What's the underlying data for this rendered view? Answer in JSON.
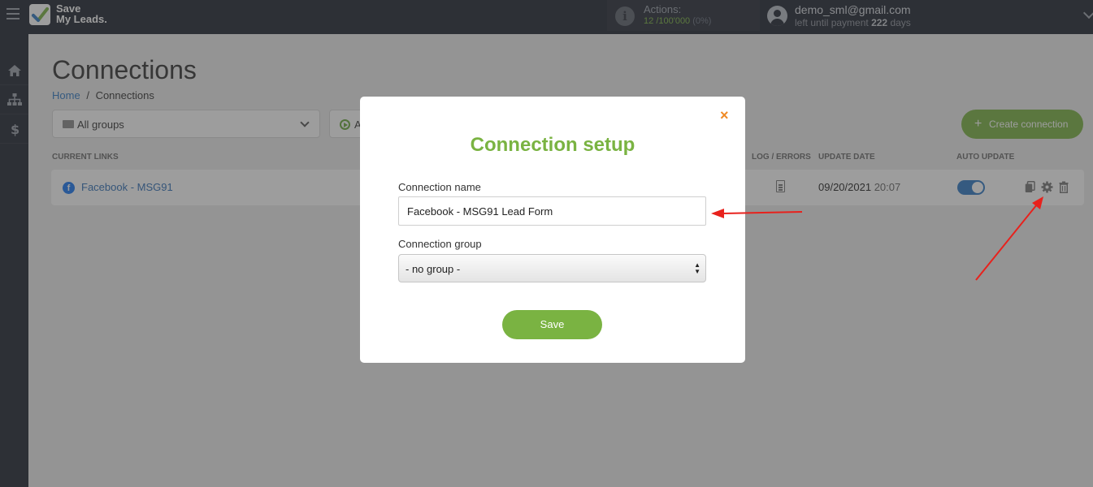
{
  "brand": {
    "name_line1": "Save",
    "name_line2": "My Leads."
  },
  "actions": {
    "label": "Actions:",
    "used": "12",
    "limit": "/100'000",
    "percent": "(0%)"
  },
  "user": {
    "email": "demo_sml@gmail.com",
    "sub_prefix": "left until payment",
    "days": "222",
    "sub_suffix": "days"
  },
  "page": {
    "title": "Connections"
  },
  "breadcrumb": {
    "home": "Home",
    "separator": "/",
    "current": "Connections"
  },
  "filters": {
    "group_select": "All groups",
    "status_select": "A"
  },
  "create_button": {
    "plus": "+",
    "label": "Create connection"
  },
  "table": {
    "headers": {
      "current_links": "CURRENT LINKS",
      "log_errors": "LOG / ERRORS",
      "update_date": "UPDATE DATE",
      "auto_update": "AUTO UPDATE"
    },
    "rows": [
      {
        "name": "Facebook - MSG91",
        "date": "09/20/2021",
        "time": "20:07",
        "auto_update": true
      }
    ]
  },
  "modal": {
    "close": "×",
    "title": "Connection setup",
    "name_label": "Connection name",
    "name_value": "Facebook - MSG91 Lead Form",
    "group_label": "Connection group",
    "group_value": "- no group -",
    "save": "Save"
  },
  "colors": {
    "accent_green": "#7ab342",
    "link_blue": "#2f78c4",
    "close_orange": "#f08a24",
    "annotation_red": "#e8211c"
  }
}
